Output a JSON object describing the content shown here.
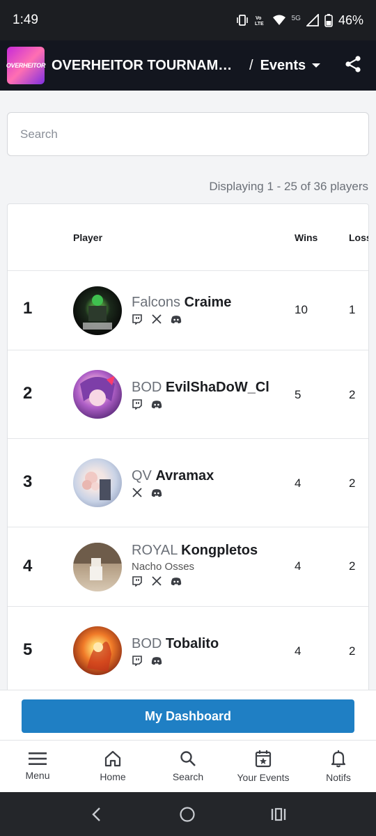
{
  "status_bar": {
    "time": "1:49",
    "network": "5G",
    "battery": "46%"
  },
  "app_bar": {
    "logo_text": "OVERHEITOR",
    "title": "OVERHEITOR TOURNAMENT",
    "breadcrumb_separator": "/",
    "section": "Events"
  },
  "search": {
    "placeholder": "Search"
  },
  "displaying_text": "Displaying 1 - 25 of 36 players",
  "table": {
    "headers": {
      "player": "Player",
      "wins": "Wins",
      "losses": "Losses"
    },
    "rows": [
      {
        "rank": "1",
        "tag": "Falcons",
        "gamer_tag": "Craime",
        "real_name": "",
        "socials": [
          "twitch",
          "x",
          "discord"
        ],
        "wins": "10",
        "losses": "1"
      },
      {
        "rank": "2",
        "tag": "BOD",
        "gamer_tag": "EvilShaDoW_Cl",
        "real_name": "",
        "socials": [
          "twitch",
          "discord"
        ],
        "wins": "5",
        "losses": "2"
      },
      {
        "rank": "3",
        "tag": "QV",
        "gamer_tag": "Avramax",
        "real_name": "",
        "socials": [
          "x",
          "discord"
        ],
        "wins": "4",
        "losses": "2"
      },
      {
        "rank": "4",
        "tag": "ROYAL",
        "gamer_tag": "Kongpletos",
        "real_name": "Nacho Osses",
        "socials": [
          "twitch",
          "x",
          "discord"
        ],
        "wins": "4",
        "losses": "2"
      },
      {
        "rank": "5",
        "tag": "BOD",
        "gamer_tag": "Tobalito",
        "real_name": "",
        "socials": [
          "twitch",
          "discord"
        ],
        "wins": "4",
        "losses": "2"
      }
    ]
  },
  "dashboard_button": "My Dashboard",
  "tabs": [
    {
      "label": "Menu",
      "icon": "menu-icon"
    },
    {
      "label": "Home",
      "icon": "home-icon"
    },
    {
      "label": "Search",
      "icon": "search-icon"
    },
    {
      "label": "Your Events",
      "icon": "calendar-star-icon"
    },
    {
      "label": "Notifs",
      "icon": "bell-icon"
    }
  ],
  "colors": {
    "primary": "#1f7fc4",
    "app_bar": "#13161f",
    "status_bar": "#1c1e22"
  }
}
